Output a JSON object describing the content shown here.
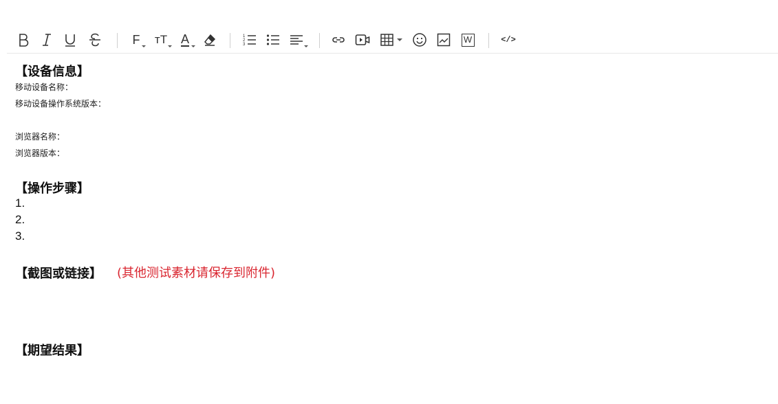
{
  "toolbar": {
    "buttons": [
      "bold-icon",
      "italic-icon",
      "underline-icon",
      "strikethrough-icon",
      "font-family-icon",
      "font-size-icon",
      "font-color-icon",
      "clear-format-icon",
      "ordered-list-icon",
      "unordered-list-icon",
      "align-icon",
      "link-icon",
      "video-icon",
      "table-icon",
      "emoji-icon",
      "image-icon",
      "word-import-icon",
      "source-code-icon"
    ],
    "font_family_glyph": "F",
    "font_size_glyph": "тT",
    "font_color_glyph": "A",
    "word_glyph": "W",
    "code_glyph": "</>",
    "ordered_nums": [
      "1",
      "2",
      "3"
    ]
  },
  "content": {
    "device_heading": "【设备信息】",
    "device_name_label": "移动设备名称：",
    "device_os_label": "移动设备操作系统版本：",
    "browser_name_label": "浏览器名称：",
    "browser_version_label": "浏览器版本：",
    "steps_heading": "【操作步骤】",
    "steps": [
      "1.",
      "2.",
      "3."
    ],
    "screenshot_heading": "【截图或链接】",
    "screenshot_note": "(其他测试素材请保存到附件)",
    "expected_heading": "【期望结果】"
  },
  "colors": {
    "note_red": "#d9252f",
    "divider": "#e8e8e8",
    "icon": "#333333"
  }
}
